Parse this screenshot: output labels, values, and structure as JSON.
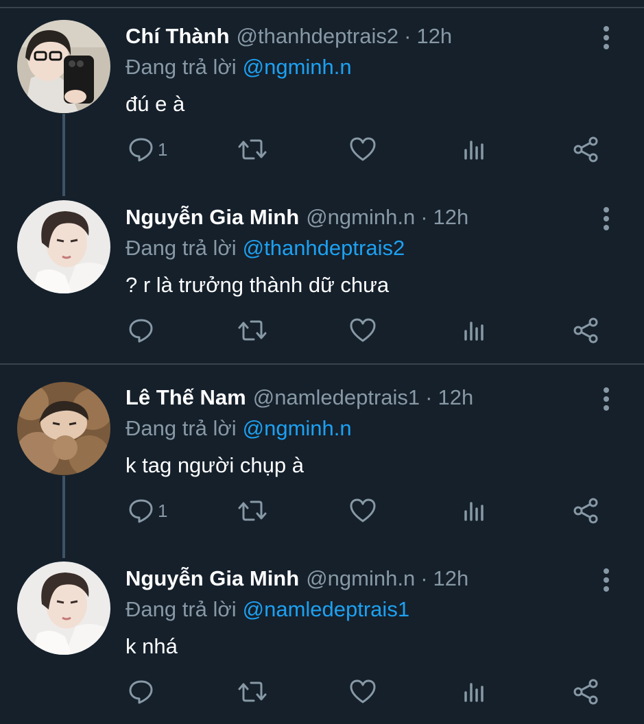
{
  "colors": {
    "background": "#15202b",
    "divider": "#38444d",
    "secondary_text": "#8899a6",
    "link": "#1da1f2",
    "primary_text": "#ffffff"
  },
  "replying_label": "Đang trả lời",
  "tweets": [
    {
      "name": "Chí Thành",
      "handle": "@thanhdeptrais2",
      "separator": "·",
      "time": "12h",
      "replying_to": "@ngminh.n",
      "text": "đú e à",
      "reply_count": "1",
      "icons": [
        "reply-icon",
        "retweet-icon",
        "like-icon",
        "analytics-icon",
        "share-icon",
        "more-icon"
      ]
    },
    {
      "name": "Nguyễn Gia Minh",
      "handle": "@ngminh.n",
      "separator": "·",
      "time": "12h",
      "replying_to": "@thanhdeptrais2",
      "text": "? r là trưởng thành dữ chưa",
      "reply_count": "",
      "icons": [
        "reply-icon",
        "retweet-icon",
        "like-icon",
        "analytics-icon",
        "share-icon",
        "more-icon"
      ]
    },
    {
      "name": "Lê Thế Nam",
      "handle": "@namledeptrais1",
      "separator": "·",
      "time": "12h",
      "replying_to": "@ngminh.n",
      "text": "k tag người chụp à",
      "reply_count": "1",
      "icons": [
        "reply-icon",
        "retweet-icon",
        "like-icon",
        "analytics-icon",
        "share-icon",
        "more-icon"
      ]
    },
    {
      "name": "Nguyễn Gia Minh",
      "handle": "@ngminh.n",
      "separator": "·",
      "time": "12h",
      "replying_to": "@namledeptrais1",
      "text": "k nhá",
      "reply_count": "",
      "icons": [
        "reply-icon",
        "retweet-icon",
        "like-icon",
        "analytics-icon",
        "share-icon",
        "more-icon"
      ]
    }
  ]
}
